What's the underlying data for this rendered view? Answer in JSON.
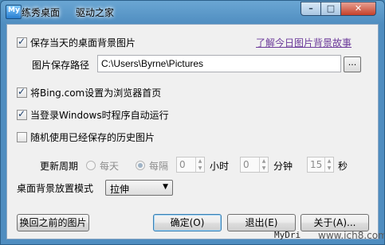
{
  "window": {
    "title": "练秀桌面",
    "title_extra": "驱动之家",
    "app_icon_text": "My",
    "titlebar_buttons": {
      "minimize": "–",
      "maximize": "□",
      "close": "✕"
    }
  },
  "options": {
    "save_daily": {
      "label": "保存当天的桌面背景图片",
      "checked": true
    },
    "story_link": "了解今日图片背景故事",
    "save_path": {
      "label": "图片保存路径",
      "value": "C:\\Users\\Byrne\\Pictures",
      "browse_label": "..."
    },
    "set_homepage": {
      "label": "将Bing.com设置为浏览器首页",
      "checked": true
    },
    "autorun": {
      "label": "当登录Windows时程序自动运行",
      "checked": true
    },
    "random_history": {
      "label": "随机使用已经保存的历史图片",
      "checked": false
    }
  },
  "update_period": {
    "label": "更新周期",
    "daily_label": "每天",
    "interval_label": "每隔",
    "selected": "interval",
    "hours": "0",
    "hours_unit": "小时",
    "minutes": "0",
    "minutes_unit": "分钟",
    "seconds": "15",
    "seconds_unit": "秒"
  },
  "layout_mode": {
    "label": "桌面背景放置模式",
    "value": "拉伸"
  },
  "buttons": {
    "restore": "换回之前的图片",
    "ok": "确定(O)",
    "exit": "退出(E)",
    "about": "关于(A)..."
  },
  "watermark": {
    "app": "MyDri",
    "site": "www.ich8.com"
  }
}
